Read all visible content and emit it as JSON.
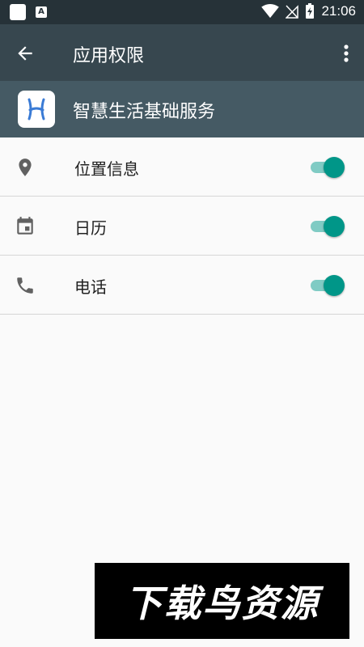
{
  "status_bar": {
    "time": "21:06",
    "notification_icons": [
      "square-icon",
      "font-a-icon"
    ],
    "system_icons": [
      "wifi-icon",
      "signal-off-icon",
      "battery-charging-icon"
    ]
  },
  "app_bar": {
    "title": "应用权限",
    "back_icon": "arrow-back-icon",
    "more_icon": "more-vert-icon"
  },
  "app": {
    "name": "智慧生活基础服务",
    "icon": "app-logo-icon"
  },
  "permissions": [
    {
      "label": "位置信息",
      "icon": "location-pin-icon",
      "enabled": true
    },
    {
      "label": "日历",
      "icon": "calendar-icon",
      "enabled": true
    },
    {
      "label": "电话",
      "icon": "phone-icon",
      "enabled": true
    }
  ],
  "watermark": {
    "text": "下载鸟资源"
  },
  "colors": {
    "status_bar": "#263238",
    "app_bar": "#37474f",
    "app_header": "#455a64",
    "switch_thumb": "#009688",
    "switch_track": "#80cbc4",
    "background": "#fafafa"
  }
}
